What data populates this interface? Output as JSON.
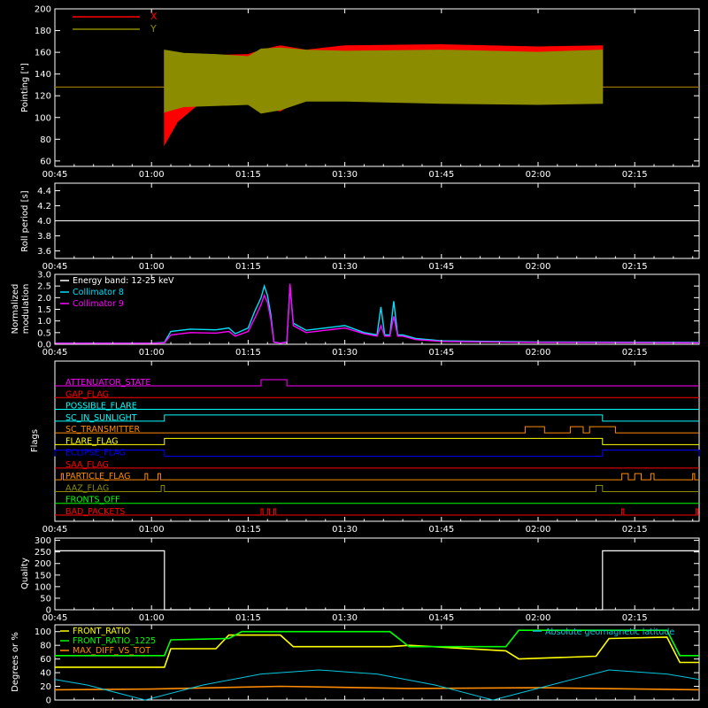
{
  "time_axis": {
    "range": [
      "00:45",
      "02:25"
    ],
    "ticks": [
      "00:45",
      "01:00",
      "01:15",
      "01:30",
      "01:45",
      "02:00",
      "02:15"
    ]
  },
  "chart_data": [
    {
      "id": "pointing",
      "type": "line",
      "ylabel": "Pointing [\"]",
      "ylim": [
        55,
        200
      ],
      "yticks": [
        60,
        80,
        100,
        120,
        140,
        160,
        180,
        200
      ],
      "legend": "top-left",
      "series": [
        {
          "name": "X",
          "color": "#ff0000",
          "baseline": 128,
          "start": "01:02",
          "end": "02:10",
          "x": [
            "01:02",
            "01:04",
            "01:08",
            "01:15",
            "01:17",
            "01:20",
            "01:24",
            "01:30",
            "01:45",
            "02:00",
            "02:10"
          ],
          "upper": [
            160,
            150,
            157,
            158,
            162,
            166,
            162,
            166,
            167,
            165,
            166
          ],
          "lower": [
            75,
            96,
            116,
            121,
            110,
            106,
            120,
            126,
            126,
            126,
            124
          ]
        },
        {
          "name": "Y",
          "color": "#8c8c00",
          "baseline": 128,
          "start": "01:02",
          "end": "02:10",
          "x": [
            "01:02",
            "01:05",
            "01:10",
            "01:15",
            "01:17",
            "01:20",
            "01:24",
            "01:30",
            "01:45",
            "02:00",
            "02:10"
          ],
          "upper": [
            162,
            159,
            158,
            156,
            163,
            164,
            162,
            161,
            162,
            160,
            162
          ],
          "lower": [
            105,
            110,
            111,
            112,
            104,
            107,
            115,
            115,
            113,
            112,
            113
          ]
        }
      ]
    },
    {
      "id": "roll",
      "type": "line",
      "ylabel": "Roll period [s]",
      "ylim": [
        3.5,
        4.5
      ],
      "yticks": [
        3.6,
        3.8,
        4.0,
        4.2,
        4.4
      ],
      "series": [
        {
          "name": "",
          "color": "#ffffff",
          "x": [
            "00:45",
            "02:25"
          ],
          "y": [
            4.0,
            4.0
          ]
        }
      ]
    },
    {
      "id": "modulation",
      "type": "line",
      "ylabel": "Normalized modulation",
      "ylim": [
        0,
        3
      ],
      "yticks": [
        0.0,
        0.5,
        1.0,
        1.5,
        2.0,
        2.5,
        3.0
      ],
      "legend": "top-left",
      "annotation": "Energy band: 12-25 keV",
      "series": [
        {
          "name": "Collimator 8",
          "color": "#00e0ff",
          "x": [
            "00:45",
            "01:00",
            "01:02",
            "01:03",
            "01:06",
            "01:10",
            "01:12",
            "01:13",
            "01:15",
            "01:16",
            "01:17",
            "01:17.5",
            "01:18",
            "01:18.5",
            "01:19",
            "01:20",
            "01:21",
            "01:21.5",
            "01:22",
            "01:24",
            "01:27",
            "01:30",
            "01:33",
            "01:35",
            "01:35.6",
            "01:36.2",
            "01:37",
            "01:37.6",
            "01:38.2",
            "01:39",
            "01:41",
            "01:45",
            "02:00",
            "02:25"
          ],
          "y": [
            0.05,
            0.05,
            0.08,
            0.55,
            0.65,
            0.62,
            0.7,
            0.45,
            0.7,
            1.4,
            2.0,
            2.5,
            2.1,
            1.3,
            0.1,
            0.05,
            0.1,
            2.5,
            0.9,
            0.6,
            0.7,
            0.8,
            0.5,
            0.4,
            1.6,
            0.4,
            0.4,
            1.85,
            0.4,
            0.4,
            0.25,
            0.15,
            0.1,
            0.08
          ]
        },
        {
          "name": "Collimator 9",
          "color": "#ff00ff",
          "x": [
            "00:45",
            "01:00",
            "01:02",
            "01:03",
            "01:06",
            "01:10",
            "01:12",
            "01:13",
            "01:15",
            "01:16",
            "01:17",
            "01:17.5",
            "01:18",
            "01:18.5",
            "01:19",
            "01:20",
            "01:21",
            "01:21.5",
            "01:22",
            "01:24",
            "01:27",
            "01:30",
            "01:33",
            "01:35",
            "01:35.6",
            "01:36.2",
            "01:37",
            "01:37.6",
            "01:38.2",
            "01:39",
            "01:41",
            "01:45",
            "02:00",
            "02:25"
          ],
          "y": [
            0.04,
            0.04,
            0.06,
            0.4,
            0.5,
            0.48,
            0.55,
            0.35,
            0.55,
            1.1,
            1.7,
            2.1,
            1.8,
            1.1,
            0.08,
            0.05,
            0.08,
            2.6,
            0.8,
            0.5,
            0.6,
            0.7,
            0.45,
            0.35,
            0.8,
            0.35,
            0.35,
            1.2,
            0.35,
            0.35,
            0.2,
            0.12,
            0.08,
            0.06
          ]
        }
      ]
    },
    {
      "id": "flags",
      "type": "line",
      "ylabel": "Flags",
      "flags": [
        {
          "name": "ATTENUATOR_STATE",
          "color": "#ff00ff",
          "on": [
            [
              "01:17",
              "01:21"
            ]
          ]
        },
        {
          "name": "GAP_FLAG",
          "color": "#ff0000",
          "on": []
        },
        {
          "name": "POSSIBLE_FLARE",
          "color": "#00ffff",
          "on": []
        },
        {
          "name": "SC_IN_SUNLIGHT",
          "color": "#00ffff",
          "on": [
            [
              "01:02",
              "02:10"
            ]
          ]
        },
        {
          "name": "SC_TRANSMITTER",
          "color": "#ff8c00",
          "on": [
            [
              "01:58",
              "02:01"
            ],
            [
              "02:05",
              "02:07"
            ],
            [
              "02:08",
              "02:12"
            ]
          ]
        },
        {
          "name": "FLARE_FLAG",
          "color": "#ffff00",
          "on": [
            [
              "01:02",
              "02:10"
            ]
          ]
        },
        {
          "name": "ECLIPSE_FLAG",
          "color": "#0000ff",
          "on": [
            [
              "00:45",
              "01:02"
            ],
            [
              "02:10",
              "02:25"
            ]
          ]
        },
        {
          "name": "SAA_FLAG",
          "color": "#ff0000",
          "on": []
        },
        {
          "name": "PARTICLE_FLAG",
          "color": "#ff8c00",
          "on": [
            [
              "00:46",
              "00:46.3"
            ],
            [
              "00:59",
              "00:59.4"
            ],
            [
              "01:01",
              "01:01.4"
            ],
            [
              "02:13",
              "02:14"
            ],
            [
              "02:15",
              "02:16"
            ],
            [
              "02:17.5",
              "02:18"
            ],
            [
              "02:24",
              "02:24.3"
            ]
          ]
        },
        {
          "name": "AAZ_FLAG",
          "color": "#8c8c00",
          "on": [
            [
              "01:01.5",
              "01:02"
            ],
            [
              "02:09",
              "02:10"
            ]
          ]
        },
        {
          "name": "FRONTS_OFF",
          "color": "#00ff00",
          "on": []
        },
        {
          "name": "BAD_PACKETS",
          "color": "#ff0000",
          "on": [
            [
              "01:17",
              "01:17.3"
            ],
            [
              "01:18",
              "01:18.3"
            ],
            [
              "01:19",
              "01:19.3"
            ],
            [
              "02:13",
              "02:13.3"
            ],
            [
              "02:24.5",
              "02:24.8"
            ]
          ]
        }
      ]
    },
    {
      "id": "quality",
      "type": "line",
      "ylabel": "Quality",
      "ylim": [
        0,
        310
      ],
      "yticks": [
        0,
        50,
        100,
        150,
        200,
        250,
        300
      ],
      "series": [
        {
          "name": "",
          "color": "#ffffff",
          "x": [
            "00:45",
            "01:02",
            "01:02",
            "02:10",
            "02:10",
            "02:25"
          ],
          "y": [
            255,
            255,
            0,
            0,
            255,
            255
          ]
        }
      ]
    },
    {
      "id": "geo",
      "type": "line",
      "ylabel": "Degrees or %",
      "ylim": [
        0,
        110
      ],
      "yticks": [
        0,
        20,
        40,
        60,
        80,
        100
      ],
      "legend": "top-left",
      "series": [
        {
          "name": "FRONT_RATIO",
          "color": "#ffff00",
          "x": [
            "00:45",
            "01:02",
            "01:03",
            "01:10",
            "01:12",
            "01:20",
            "01:22",
            "01:37",
            "01:40",
            "01:55",
            "01:57",
            "02:09",
            "02:11",
            "02:20",
            "02:22",
            "02:25"
          ],
          "y": [
            48,
            48,
            75,
            75,
            95,
            95,
            78,
            78,
            80,
            72,
            60,
            64,
            90,
            92,
            55,
            55
          ]
        },
        {
          "name": "FRONT_RATIO_1225",
          "color": "#00ff00",
          "x": [
            "00:45",
            "01:02",
            "01:03",
            "01:12",
            "01:14",
            "01:37",
            "01:40",
            "01:55",
            "01:57",
            "02:20",
            "02:22",
            "02:25"
          ],
          "y": [
            65,
            65,
            88,
            90,
            100,
            100,
            78,
            78,
            102,
            102,
            65,
            65
          ]
        },
        {
          "name": "MAX_DIFF_VS_TOT",
          "color": "#ff8c00",
          "x": [
            "00:45",
            "01:00",
            "01:20",
            "01:40",
            "02:00",
            "02:25"
          ],
          "y": [
            15,
            16,
            20,
            17,
            18,
            15
          ]
        },
        {
          "name": "Absolute geomagnetic latitude",
          "color": "#00c8e0",
          "x": [
            "00:45",
            "00:50",
            "00:59",
            "01:08",
            "01:17",
            "01:26",
            "01:35",
            "01:44",
            "01:53",
            "02:02",
            "02:11",
            "02:20",
            "02:25"
          ],
          "y": [
            30,
            22,
            0,
            22,
            38,
            44,
            38,
            22,
            0,
            22,
            44,
            38,
            30
          ]
        }
      ]
    }
  ]
}
